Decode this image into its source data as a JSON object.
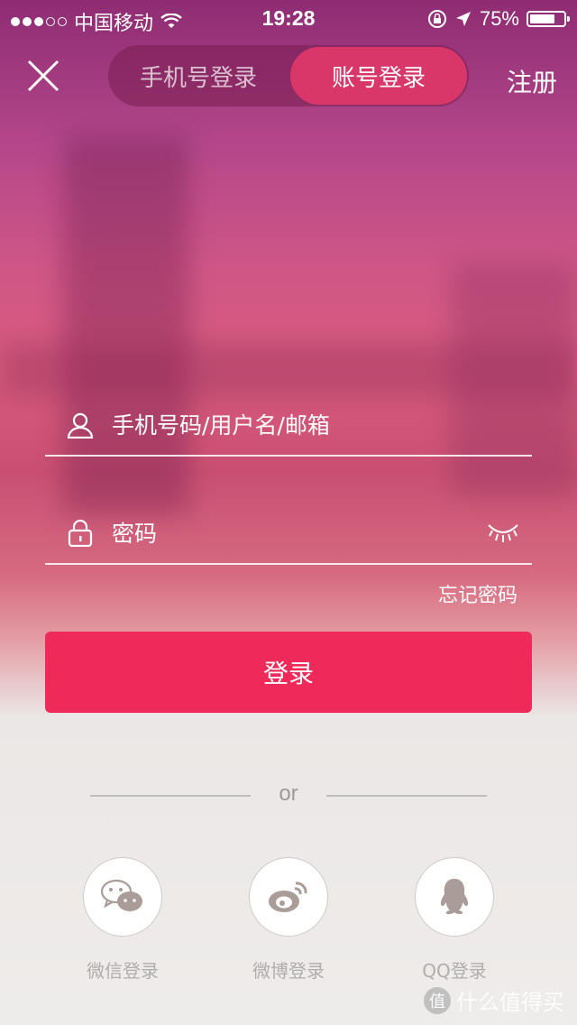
{
  "status_bar": {
    "carrier": "中国移动",
    "time": "19:28",
    "battery": "75%",
    "battery_level": 0.75
  },
  "header": {
    "close_icon": "close-icon",
    "tabs": [
      {
        "label": "手机号登录",
        "active": false
      },
      {
        "label": "账号登录",
        "active": true
      }
    ],
    "register_label": "注册"
  },
  "form": {
    "account_placeholder": "手机号码/用户名/邮箱",
    "password_placeholder": "密码",
    "forgot_label": "忘记密码",
    "login_label": "登录"
  },
  "divider": {
    "text": "or"
  },
  "social": [
    {
      "label": "微信登录",
      "icon": "wechat-icon"
    },
    {
      "label": "微博登录",
      "icon": "weibo-icon"
    },
    {
      "label": "QQ登录",
      "icon": "qq-icon"
    }
  ],
  "watermark": {
    "badge": "值",
    "text": "什么值得买"
  },
  "colors": {
    "accent": "#ee2a5a",
    "active_tab": "#d9376a"
  }
}
